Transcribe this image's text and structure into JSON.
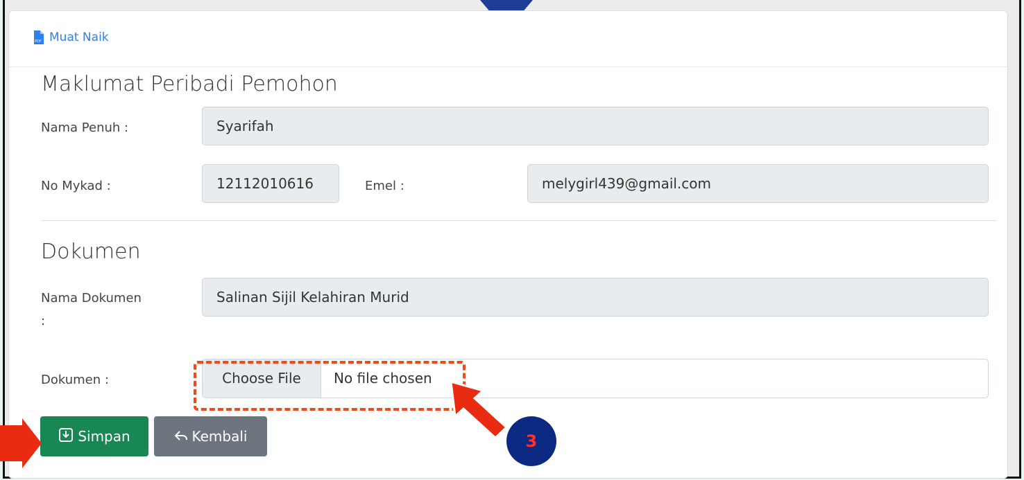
{
  "header": {
    "link_label": "Muat Naik",
    "icon": "pdf-upload-icon"
  },
  "personal_section": {
    "title": "Maklumat Peribadi Pemohon",
    "name_label": "Nama Penuh :",
    "name_value": "Syarifah",
    "mykad_label": "No Mykad :",
    "mykad_value": "12112010616",
    "email_label": "Emel :",
    "email_value": "melygirl439@gmail.com"
  },
  "document_section": {
    "title": "Dokumen",
    "doc_name_label": "Nama Dokumen",
    "doc_name_colon": ":",
    "doc_name_value": "Salinan Sijil Kelahiran Murid",
    "file_label": "Dokumen :",
    "choose_file_label": "Choose File",
    "file_status": "No file chosen"
  },
  "actions": {
    "save_label": "Simpan",
    "back_label": "Kembali"
  },
  "annotation": {
    "step_number": "3",
    "accent_color": "#f04a18",
    "badge_color": "#0d2a82"
  }
}
